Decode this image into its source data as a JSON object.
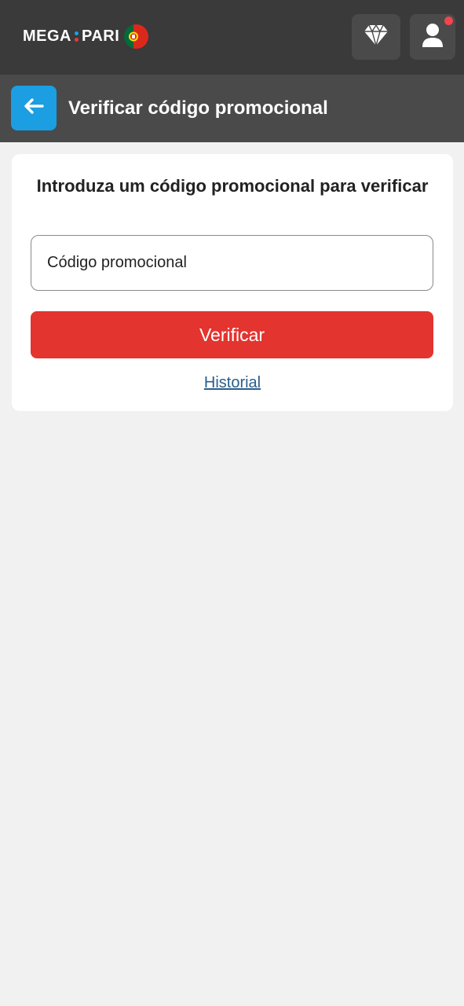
{
  "header": {
    "logo_left": "MEGA",
    "logo_right": "PARI",
    "notification": true
  },
  "subheader": {
    "title": "Verificar código promocional",
    "back_icon": "arrow-left-icon"
  },
  "promo_form": {
    "heading": "Introduza um código promocional para verificar",
    "input_placeholder": "Código promocional",
    "input_value": "",
    "submit_label": "Verificar",
    "history_label": "Historial"
  },
  "icons": {
    "rewards": "diamond-icon",
    "account": "user-icon",
    "flag": "portugal-flag-icon"
  },
  "colors": {
    "header_bg": "#3a3a3a",
    "subheader_bg": "#4a4a4a",
    "accent_blue": "#1b9ee2",
    "button_red": "#e3342f",
    "link_blue": "#2a5d8a",
    "notif_red": "#f0454f",
    "logo_dot_blue": "#1ea0e6",
    "logo_dot_red": "#e83a3a",
    "page_bg": "#f1f1f1"
  }
}
